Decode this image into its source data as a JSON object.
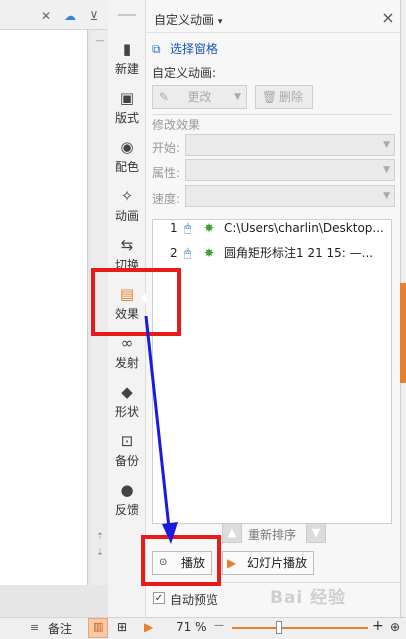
{
  "panel": {
    "title": "自定义动画",
    "title_arrow": "▾",
    "close": "×",
    "select_pane": "选择窗格",
    "custom_anim_label": "自定义动画:",
    "change_button": "更改",
    "delete_button": "删除",
    "modify_section": "修改效果",
    "start_label": "开始:",
    "property_label": "属性:",
    "speed_label": "速度:",
    "reorder_label": "重新排序",
    "play_button": "播放",
    "slideshow_button": "幻灯片播放",
    "autopreview_label": "自动预览",
    "autopreview_checked": true
  },
  "animations": [
    {
      "num": "1",
      "text": "C:\\Users\\charlin\\Desktop..."
    },
    {
      "num": "2",
      "text": "圆角矩形标注1 21 15:    —..."
    }
  ],
  "toolbar": {
    "items": [
      {
        "label": "新建",
        "icon": "new-slide-icon",
        "glyph": "▮"
      },
      {
        "label": "版式",
        "icon": "layout-icon",
        "glyph": "▣"
      },
      {
        "label": "配色",
        "icon": "palette-icon",
        "glyph": "◉"
      },
      {
        "label": "动画",
        "icon": "animation-icon",
        "glyph": "✧"
      },
      {
        "label": "切换",
        "icon": "transition-icon",
        "glyph": "⇆"
      },
      {
        "label": "效果",
        "icon": "effect-icon",
        "glyph": "▤"
      },
      {
        "label": "发射",
        "icon": "launch-icon",
        "glyph": "🔗"
      },
      {
        "label": "形状",
        "icon": "shape-icon",
        "glyph": "◆"
      },
      {
        "label": "备份",
        "icon": "backup-icon",
        "glyph": "⊡"
      },
      {
        "label": "反馈",
        "icon": "feedback-icon",
        "glyph": "●"
      }
    ]
  },
  "statusbar": {
    "notes_label": "备注",
    "zoom": "71 %",
    "zoom_minus": "—",
    "zoom_plus": "+"
  },
  "watermark": "Bai 经验",
  "colors": {
    "annotation_red": "#e81b1b",
    "annotation_blue": "#1a1ae0",
    "link_blue": "#1a55b0",
    "accent_orange": "#e87f2c"
  }
}
